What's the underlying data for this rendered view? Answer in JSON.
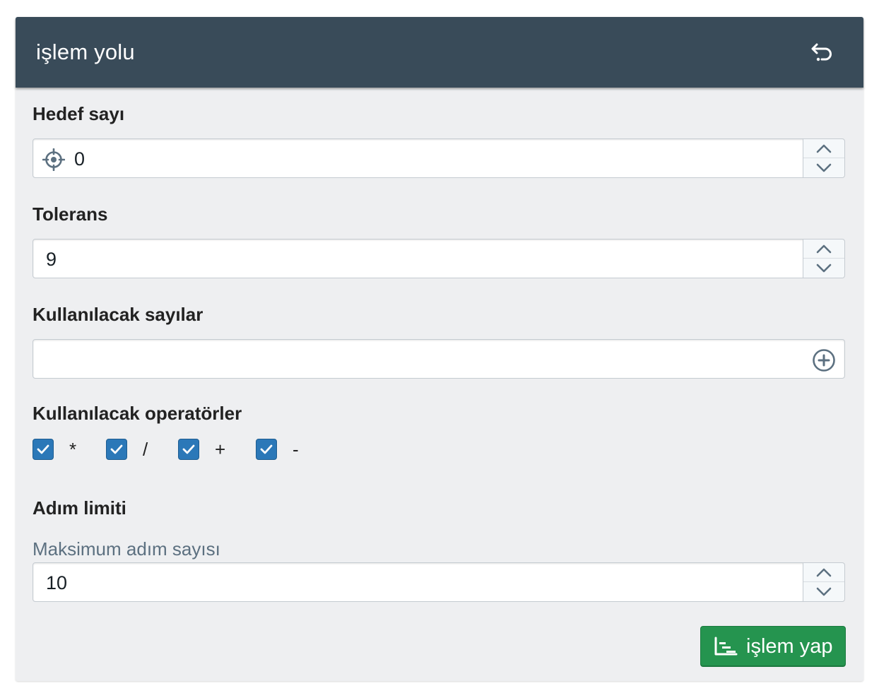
{
  "panel": {
    "title": "işlem yolu",
    "reset_icon": "undo-icon"
  },
  "target": {
    "label": "Hedef sayı",
    "value": "0",
    "icon": "target-icon"
  },
  "tolerance": {
    "label": "Tolerans",
    "value": "9"
  },
  "numbers": {
    "label": "Kullanılacak sayılar",
    "value": "",
    "add_icon": "plus-circle-icon"
  },
  "operators": {
    "label": "Kullanılacak operatörler",
    "items": [
      {
        "symbol": "*",
        "checked": true
      },
      {
        "symbol": "/",
        "checked": true
      },
      {
        "symbol": "+",
        "checked": true
      },
      {
        "symbol": "-",
        "checked": true
      }
    ]
  },
  "step_limit": {
    "label": "Adım limiti",
    "sublabel": "Maksimum adım sayısı",
    "value": "10"
  },
  "submit": {
    "label": "işlem yap",
    "icon": "chart-icon"
  },
  "colors": {
    "header": "#394b59",
    "panel_bg": "#eeeff1",
    "checkbox": "#2b78b8",
    "submit": "#25944f"
  }
}
